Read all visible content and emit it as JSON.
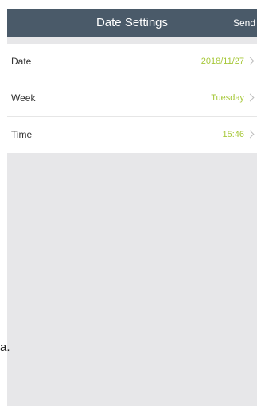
{
  "navbar": {
    "title": "Date Settings",
    "send_label": "Send"
  },
  "settings": {
    "rows": [
      {
        "label": "Date",
        "value": "2018/11/27"
      },
      {
        "label": "Week",
        "value": "Tuesday"
      },
      {
        "label": "Time",
        "value": "15:46"
      }
    ]
  },
  "stray_text": "a.",
  "colors": {
    "navbar_bg": "#4a5a69",
    "value_accent": "#a7c83a",
    "screen_bg": "#e7e7e9"
  },
  "icons": {
    "row_chevron": "chevron-right-icon"
  }
}
